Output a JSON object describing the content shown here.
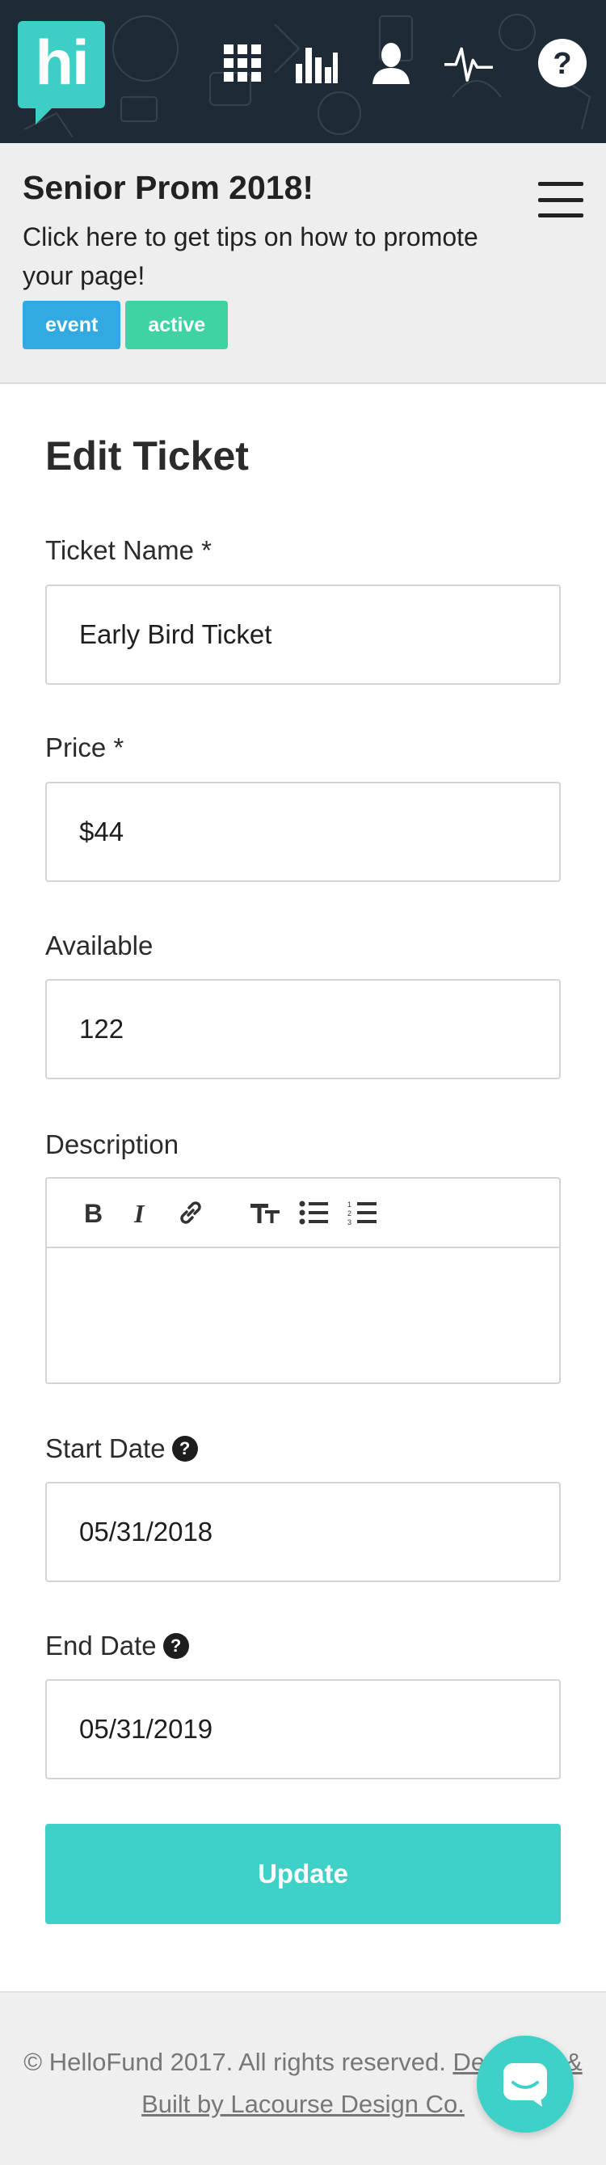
{
  "nav": {
    "logo_text": "hi",
    "icons": [
      "apps-grid-icon",
      "bar-chart-icon",
      "user-icon",
      "activity-pulse-icon",
      "help-icon"
    ]
  },
  "event": {
    "title": "Senior Prom 2018!",
    "tip": "Click here to get tips on how to promote your page!",
    "badges": {
      "type": "event",
      "status": "active"
    }
  },
  "form": {
    "title": "Edit Ticket",
    "ticket_name": {
      "label": "Ticket Name *",
      "value": "Early Bird Ticket"
    },
    "price": {
      "label": "Price *",
      "value": "$44"
    },
    "available": {
      "label": "Available",
      "value": "122"
    },
    "description": {
      "label": "Description",
      "value": ""
    },
    "start_date": {
      "label": "Start Date",
      "value": "05/31/2018"
    },
    "end_date": {
      "label": "End Date",
      "value": "05/31/2019"
    },
    "help_glyph": "?",
    "submit_label": "Update"
  },
  "footer": {
    "copyright": "© HelloFund 2017. All rights reserved.",
    "credit_link": "Designed & Built by Lacourse Design Co."
  },
  "colors": {
    "brand_teal": "#3dcfc6",
    "nav_bg": "#1e2a35",
    "badge_event": "#33a9e2",
    "badge_active": "#3fd2a4"
  }
}
